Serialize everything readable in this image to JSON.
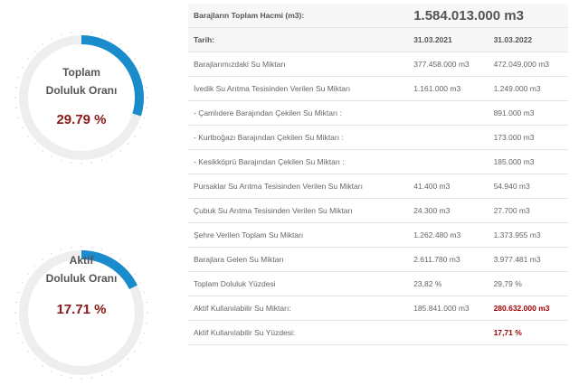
{
  "gauges": {
    "total": {
      "label_line1": "Toplam",
      "label_line2": "Doluluk Oranı",
      "percent_text": "29.79 %",
      "percent_value": 29.79
    },
    "active": {
      "label_line1": "Aktif",
      "label_line2": "Doluluk Oranı",
      "percent_text": "17.71 %",
      "percent_value": 17.71
    }
  },
  "colors": {
    "accent": "#1a8ccc",
    "track": "#eeeeee",
    "percent_text": "#8b1a1a",
    "highlight": "#a00000"
  },
  "table": {
    "title_label": "Barajların Toplam Hacmi (m3):",
    "title_value": "1.584.013.000 m3",
    "date_label": "Tarih:",
    "date_1": "31.03.2021",
    "date_2": "31.03.2022",
    "rows": [
      {
        "label": "Barajlarımızdaki Su Miktarı",
        "v1": "377.458.000 m3",
        "v2": "472.049.000 m3"
      },
      {
        "label": "İvedik Su Arıtma Tesisinden Verilen Su Miktarı",
        "v1": "1.161.000 m3",
        "v2": "1.249.000 m3"
      },
      {
        "label": "- Çamlıdere Barajından Çekilen Su Miktarı :",
        "v1": "",
        "v2": "891.000 m3"
      },
      {
        "label": "- Kurtboğazı Barajından Çekilen Su Miktarı :",
        "v1": "",
        "v2": "173.000 m3"
      },
      {
        "label": "- Kesikköprü Barajından Çekilen Su Miktarı :",
        "v1": "",
        "v2": "185.000 m3"
      },
      {
        "label": "Pursaklar Su Arıtma Tesisinden Verilen Su Miktarı",
        "v1": "41.400 m3",
        "v2": "54.940 m3"
      },
      {
        "label": "Çubuk Su Arıtma Tesisinden Verilen Su Miktarı",
        "v1": "24.300 m3",
        "v2": "27.700 m3"
      },
      {
        "label": "Şehre Verilen Toplam Su Miktarı",
        "v1": "1.262.480 m3",
        "v2": "1.373.955 m3"
      },
      {
        "label": "Barajlara Gelen Su Miktarı",
        "v1": "2.611.780 m3",
        "v2": "3.977.481 m3"
      },
      {
        "label": "Toplam Doluluk Yüzdesi",
        "v1": "23,82 %",
        "v2": "29,79 %"
      },
      {
        "label": "Aktif Kullanılabilir Su Miktarı:",
        "v1": "185.841.000 m3",
        "v2": "280.632.000 m3"
      },
      {
        "label": "Aktif Kullanılabilir Su Yüzdesi:",
        "v1": "",
        "v2": "17,71 %"
      }
    ]
  }
}
